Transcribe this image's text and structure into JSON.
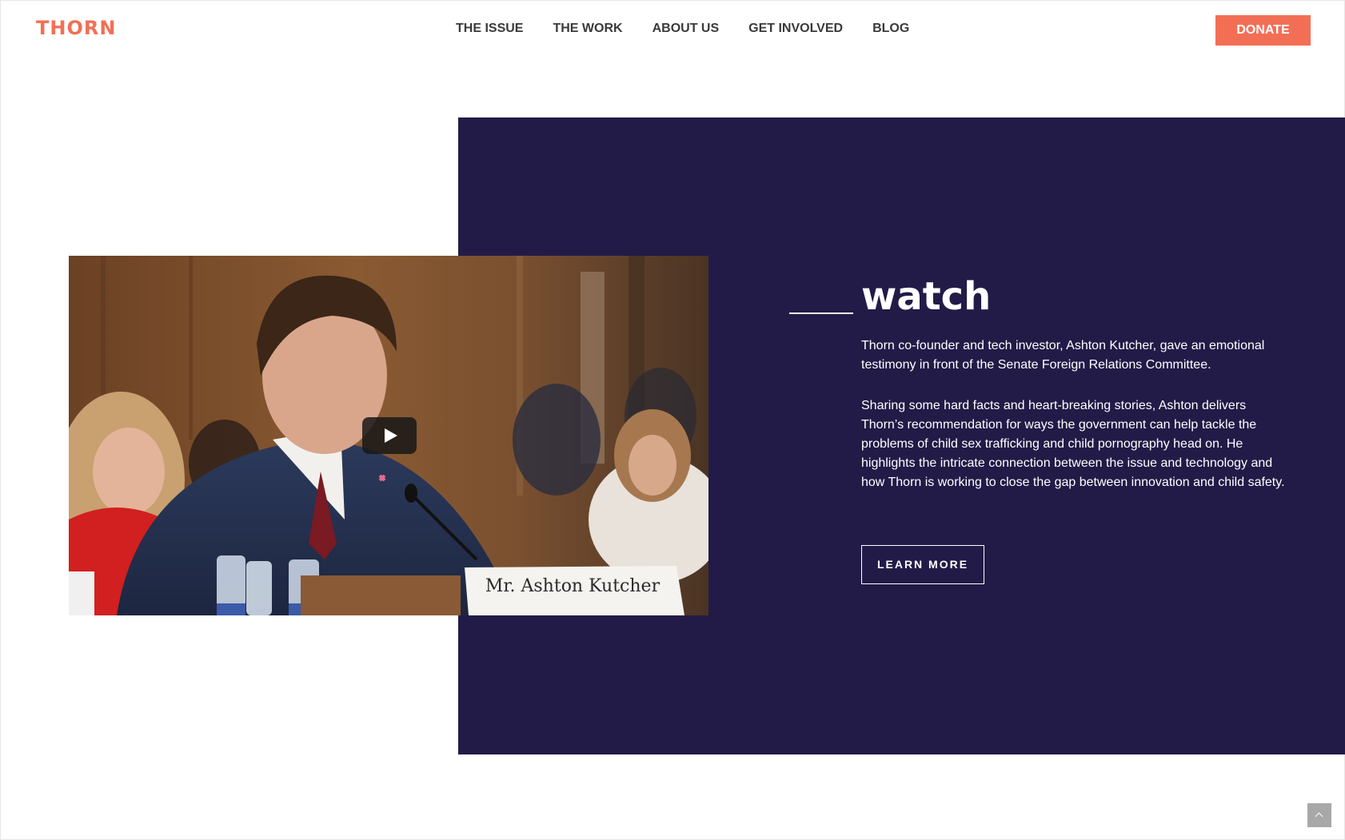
{
  "header": {
    "logo": "THORN",
    "nav": [
      "THE ISSUE",
      "THE WORK",
      "ABOUT US",
      "GET INVOLVED",
      "BLOG"
    ],
    "donate_label": "DONATE"
  },
  "watch": {
    "heading": "watch",
    "paragraph_1": "Thorn co-founder and tech investor, Ashton Kutcher, gave an emotional testimony in front of the Senate Foreign Relations Committee.",
    "paragraph_2": "Sharing some hard facts and heart-breaking stories, Ashton delivers Thorn’s recommendation for ways the government can help tackle the problems of child sex trafficking and child pornography head on. He highlights the intricate connection between the issue and technology and how Thorn is working to close the gap between innovation and child safety.",
    "learn_more_label": "LEARN MORE",
    "video": {
      "nameplate": "Mr. Ashton Kutcher",
      "play_icon": "play-icon"
    }
  },
  "colors": {
    "brand": "#f26f55",
    "panel": "#221b47",
    "nav_text": "#3a3a3a"
  }
}
